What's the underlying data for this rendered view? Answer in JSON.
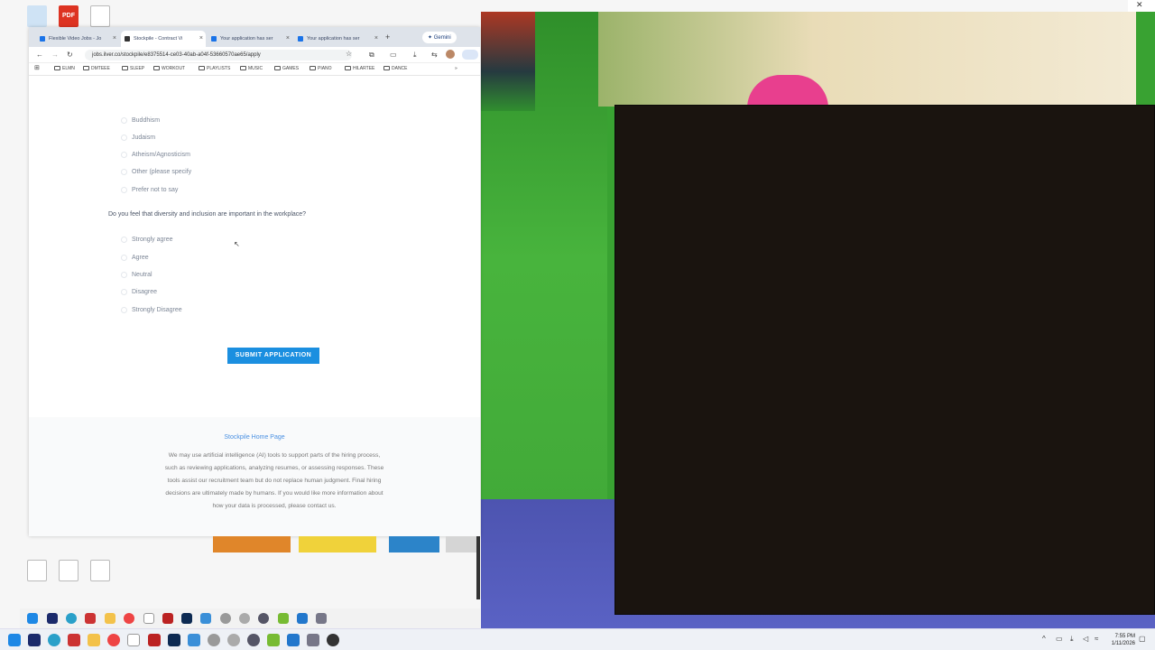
{
  "browser": {
    "tabs": [
      {
        "label": "Flexible Video Jobs - Jo"
      },
      {
        "label": "Stockpile - Contract Vi"
      },
      {
        "label": "Your application has ser"
      },
      {
        "label": "Your application has ser"
      }
    ],
    "gemini_label": "Gemini",
    "url": "jobs.ilver.co/stockpile/e8375514-ce03-40ab-a04f-53660570ae65/apply",
    "bookmarks": [
      "ELMN",
      "DMTEEE",
      "SLEEP",
      "WORKOUT",
      "PLAYLISTS",
      "MUSIC",
      "GAMES",
      "PIANO",
      "HILARTEE",
      "DANCE"
    ]
  },
  "form": {
    "religion_options": [
      "Buddhism",
      "Judaism",
      "Atheism/Agnosticism",
      "Other (please specify",
      "Prefer not to say"
    ],
    "question": "Do you feel that diversity and inclusion are important in the workplace?",
    "diversity_options": [
      "Strongly agree",
      "Agree",
      "Neutral",
      "Disagree",
      "Strongly Disagree"
    ],
    "submit_label": "SUBMIT APPLICATION"
  },
  "footer": {
    "home_link": "Stockpile Home Page",
    "ai_notice": "We may use artificial intelligence (AI) tools to support parts of the hiring process, such as reviewing applications, analyzing resumes, or assessing responses. These tools assist our recruitment team but do not replace human judgment. Final hiring decisions are ultimately made by humans. If you would like more information about how your data is processed, please contact us."
  },
  "taskbar": {
    "time": "7:55 PM",
    "date": "1/11/2026"
  }
}
